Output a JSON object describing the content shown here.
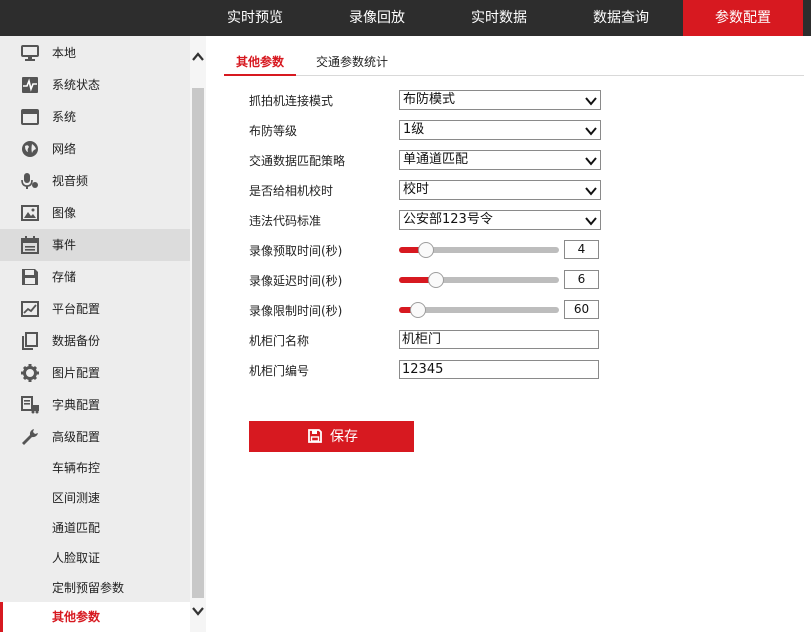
{
  "topnav": {
    "items": [
      {
        "label": "实时预览"
      },
      {
        "label": "录像回放"
      },
      {
        "label": "实时数据"
      },
      {
        "label": "数据查询"
      },
      {
        "label": "参数配置"
      }
    ],
    "active_index": 4
  },
  "sidebar": {
    "items": [
      {
        "label": "本地",
        "icon": "monitor-icon"
      },
      {
        "label": "系统状态",
        "icon": "pulse-icon"
      },
      {
        "label": "系统",
        "icon": "window-icon"
      },
      {
        "label": "网络",
        "icon": "globe-icon"
      },
      {
        "label": "视音频",
        "icon": "microphone-icon"
      },
      {
        "label": "图像",
        "icon": "image-icon"
      },
      {
        "label": "事件",
        "icon": "calendar-icon"
      },
      {
        "label": "存储",
        "icon": "floppy-icon"
      },
      {
        "label": "平台配置",
        "icon": "chart-icon"
      },
      {
        "label": "数据备份",
        "icon": "copy-icon"
      },
      {
        "label": "图片配置",
        "icon": "gear-icon"
      },
      {
        "label": "字典配置",
        "icon": "document-truck-icon"
      },
      {
        "label": "高级配置",
        "icon": "wrench-icon"
      }
    ],
    "sub_items": [
      {
        "label": "车辆布控"
      },
      {
        "label": "区间测速"
      },
      {
        "label": "通道匹配"
      },
      {
        "label": "人脸取证"
      },
      {
        "label": "定制预留参数"
      },
      {
        "label": "其他参数"
      }
    ]
  },
  "tabs": [
    {
      "label": "其他参数"
    },
    {
      "label": "交通参数统计"
    }
  ],
  "form": {
    "capture_mode": {
      "label": "抓拍机连接模式",
      "value": "布防模式"
    },
    "arm_level": {
      "label": "布防等级",
      "value": "1级"
    },
    "match_strategy": {
      "label": "交通数据匹配策略",
      "value": "单通道匹配"
    },
    "time_sync": {
      "label": "是否给相机校时",
      "value": "校时"
    },
    "violation_code": {
      "label": "违法代码标准",
      "value": "公安部123号令"
    },
    "prerecord": {
      "label": "录像预取时间(秒)",
      "value": "4",
      "level": 0.17
    },
    "delay": {
      "label": "录像延迟时间(秒)",
      "value": "6",
      "level": 0.23
    },
    "limit": {
      "label": "录像限制时间(秒)",
      "value": "60",
      "level": 0.12
    },
    "cabinet_name": {
      "label": "机柜门名称",
      "value": "机柜门"
    },
    "cabinet_no": {
      "label": "机柜门编号",
      "value": "12345"
    }
  },
  "save_label": "保存",
  "colors": {
    "accent": "#d71920",
    "nav_bg": "#2d2d2d",
    "sidebar_bg": "#ededed"
  }
}
